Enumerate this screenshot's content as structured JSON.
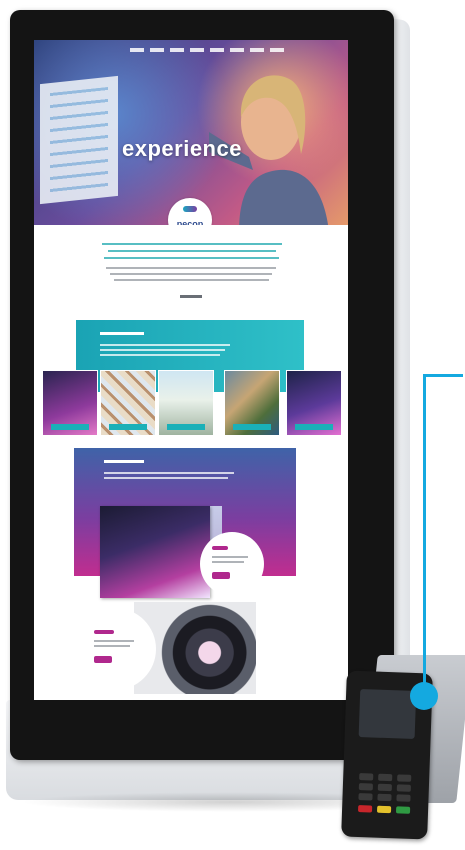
{
  "screen": {
    "hero": {
      "title": "experience",
      "logo_text": "pecop"
    }
  },
  "colors": {
    "frame": "#141414",
    "accent_teal": "#1aa3b4",
    "accent_purple": "#7b3ea0",
    "accent_magenta": "#b0288d",
    "pointer": "#14a9e0"
  },
  "icons": {
    "logo_mark": "pecop-logo-icon",
    "callout": "callout-dot-icon"
  }
}
